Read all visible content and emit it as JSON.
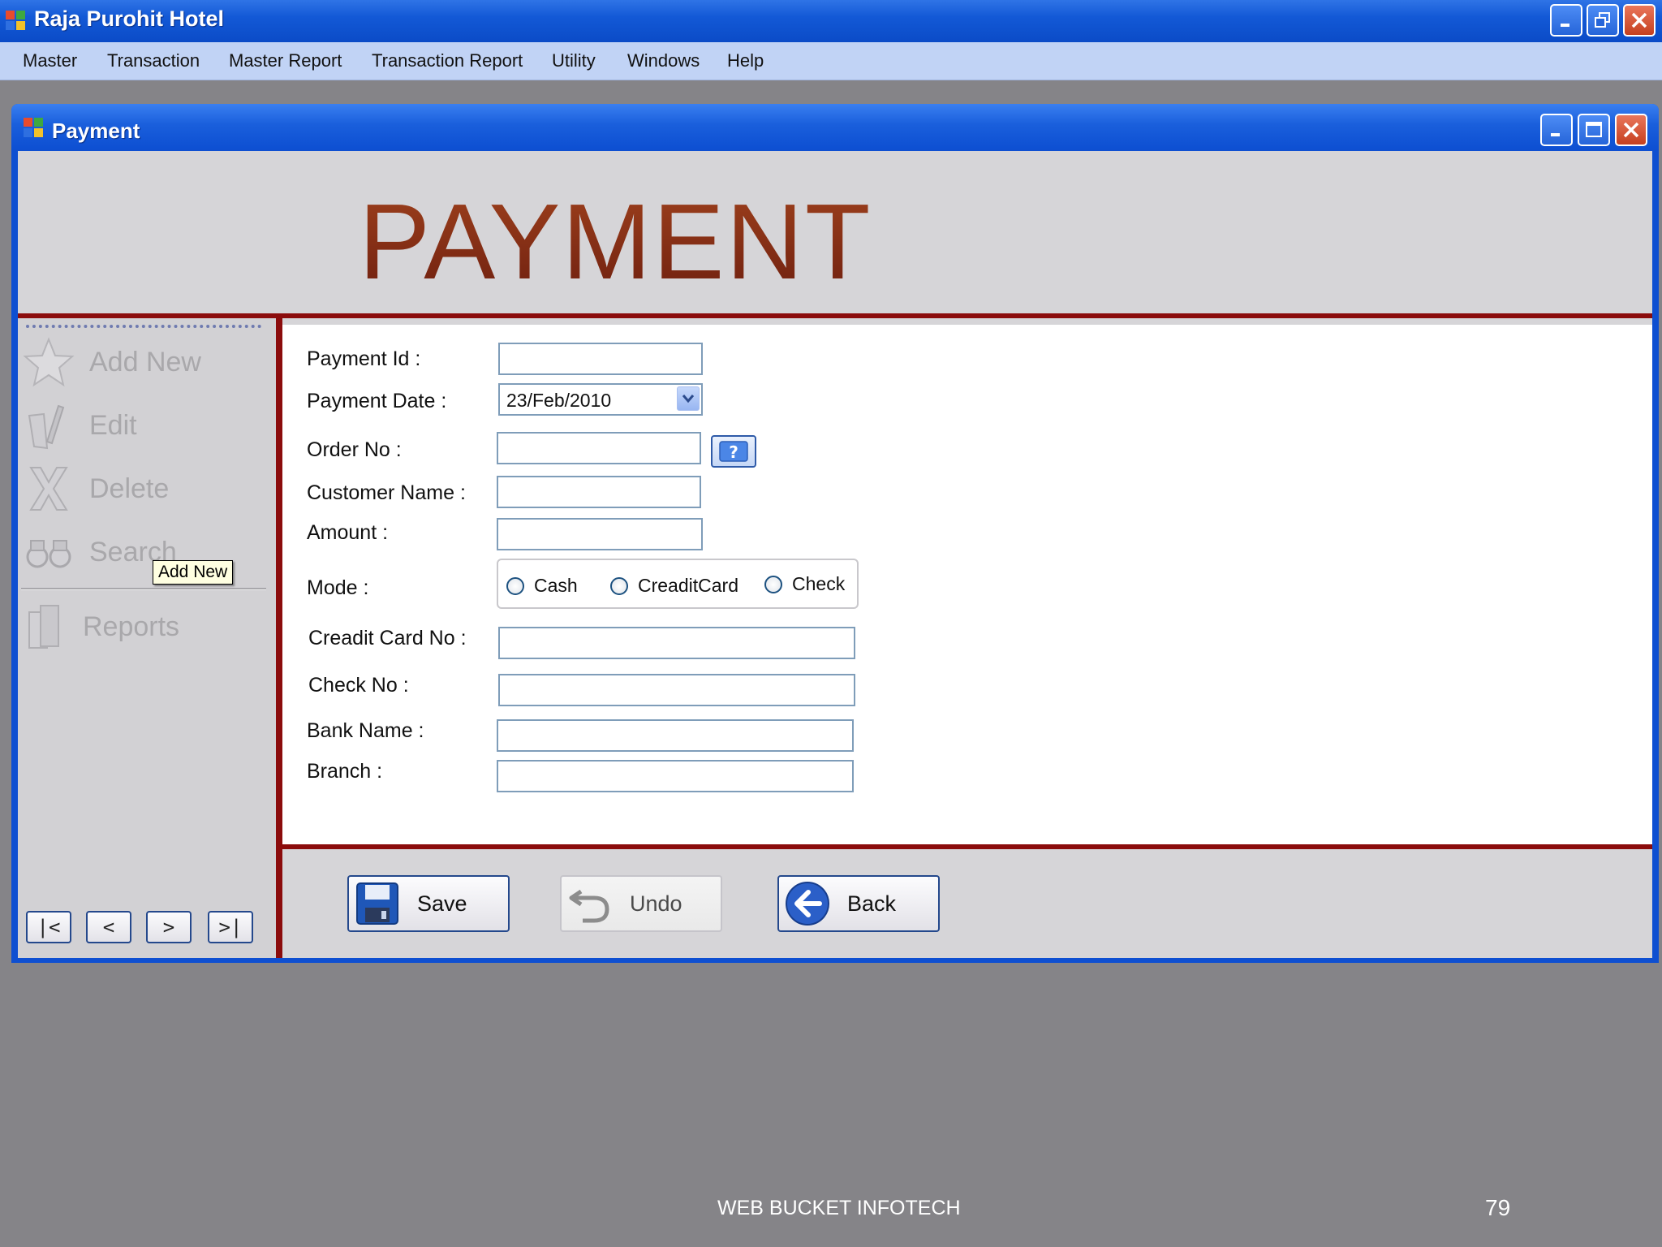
{
  "app": {
    "title": "Raja Purohit Hotel",
    "menu": [
      "Master",
      "Transaction",
      "Master Report",
      "Transaction Report",
      "Utility",
      "Windows",
      "Help"
    ]
  },
  "child_window": {
    "title": "Payment",
    "header": "PAYMENT"
  },
  "sidebar": {
    "items": [
      {
        "label": "Add New",
        "icon": "star-icon"
      },
      {
        "label": "Edit",
        "icon": "edit-icon"
      },
      {
        "label": "Delete",
        "icon": "delete-x-icon"
      },
      {
        "label": "Search",
        "icon": "binoculars-icon"
      },
      {
        "label": "Reports",
        "icon": "reports-icon"
      }
    ],
    "tooltip": "Add New",
    "nav": [
      "|<",
      "<",
      ">",
      ">|"
    ]
  },
  "form": {
    "payment_id_label": "Payment Id :",
    "payment_id_value": "",
    "payment_date_label": "Payment Date :",
    "payment_date_value": "23/Feb/2010",
    "order_no_label": "Order No :",
    "order_no_value": "",
    "customer_name_label": "Customer Name :",
    "customer_name_value": "",
    "amount_label": "Amount :",
    "amount_value": "",
    "mode_label": "Mode :",
    "modes": [
      "Cash",
      "CreaditCard",
      "Check"
    ],
    "credit_card_label": "Creadit Card No :",
    "credit_card_value": "",
    "check_no_label": "Check No :",
    "check_no_value": "",
    "bank_name_label": "Bank Name :",
    "bank_name_value": "",
    "branch_label": "Branch :",
    "branch_value": ""
  },
  "buttons": {
    "save": "Save",
    "undo": "Undo",
    "back": "Back"
  },
  "footer": {
    "company": "WEB BUCKET INFOTECH",
    "page": "79"
  },
  "colors": {
    "accent_red": "#8b0c0c",
    "title_blue": "#0e4fd1",
    "header_brown": "#8a2a14"
  }
}
